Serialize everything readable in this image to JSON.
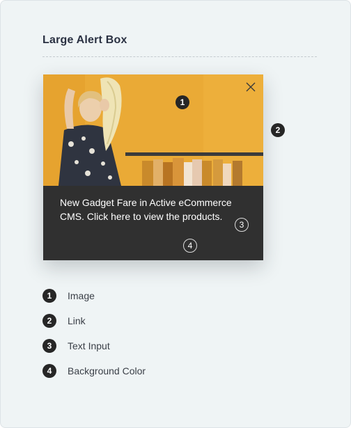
{
  "header": {
    "title": "Large Alert Box"
  },
  "alert": {
    "message": "New Gadget Fare in Active eCommerce CMS. Click here to view the products.",
    "background_color": "#303030",
    "image_background_color": "#eaaa36",
    "close_icon": "close-icon"
  },
  "markers": {
    "image": "1",
    "link": "2",
    "text_input": "3",
    "background_color": "4"
  },
  "legend": [
    {
      "number": "1",
      "label": "Image"
    },
    {
      "number": "2",
      "label": "Link"
    },
    {
      "number": "3",
      "label": "Text Input"
    },
    {
      "number": "4",
      "label": "Background Color"
    }
  ]
}
